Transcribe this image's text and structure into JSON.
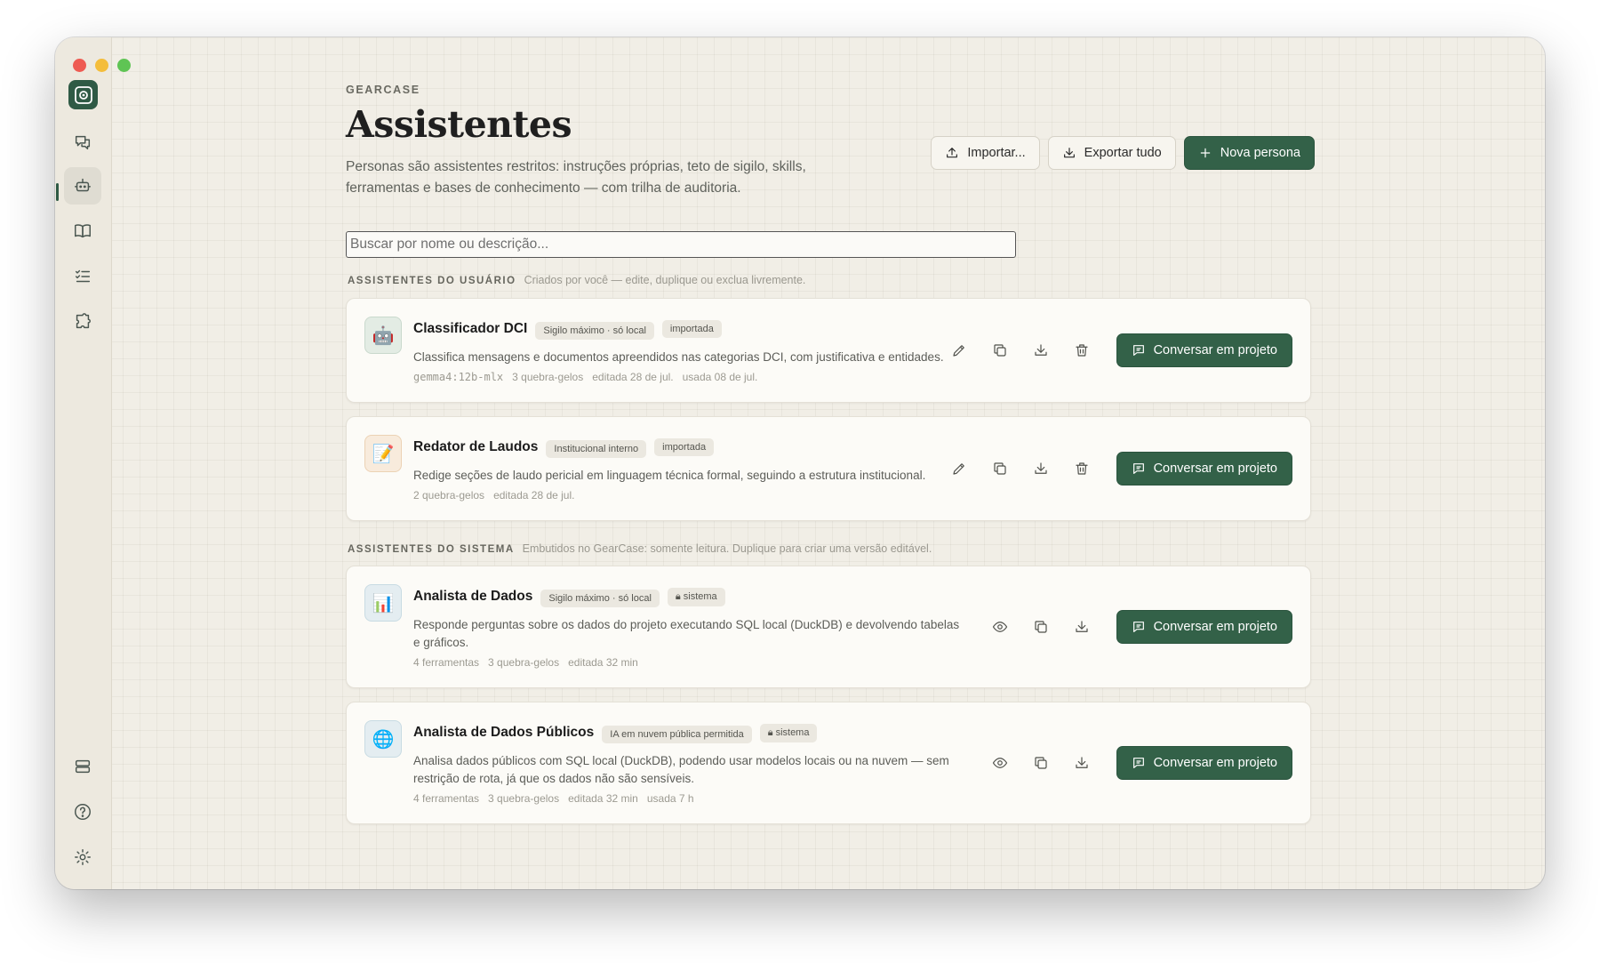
{
  "app": {
    "brand": "GEARCASE",
    "title": "Assistentes",
    "subtitle": "Personas são assistentes restritos: instruções próprias, teto de sigilo, skills, ferramentas e bases de conhecimento — com trilha de auditoria."
  },
  "actions": {
    "import_label": "Importar...",
    "export_label": "Exportar tudo",
    "new_label": "Nova persona"
  },
  "search": {
    "placeholder": "Buscar por nome ou descrição..."
  },
  "sections": [
    {
      "title": "ASSISTENTES DO USUÁRIO",
      "desc": "Criados por você — edite, duplique ou exclua livremente.",
      "cards": [
        {
          "icon": "robot-icon",
          "emoji": "🤖",
          "title": "Classificador DCI",
          "tags": [
            "Sigilo máximo · só local",
            "importada"
          ],
          "desc": "Classifica mensagens e documentos apreendidos nas categorias DCI, com justificativa e entidades.",
          "meta": [
            "gemma4:12b-mlx",
            "3 quebra-gelos",
            "editada 28 de jul.",
            "usada 08 de jul."
          ],
          "chat_label": "Conversar em projeto"
        },
        {
          "icon": "memo-icon",
          "emoji": "📝",
          "title": "Redator de Laudos",
          "tags": [
            "Institucional interno",
            "importada"
          ],
          "desc": "Redige seções de laudo pericial em linguagem técnica formal, seguindo a estrutura institucional.",
          "meta": [
            "2 quebra-gelos",
            "editada 28 de jul."
          ],
          "chat_label": "Conversar em projeto"
        }
      ]
    },
    {
      "title": "ASSISTENTES DO SISTEMA",
      "desc": "Embutidos no GearCase: somente leitura. Duplique para criar uma versão editável.",
      "cards": [
        {
          "icon": "bar-chart-icon",
          "emoji": "📊",
          "title": "Analista de Dados",
          "tags": [
            "Sigilo máximo · só local",
            "sistema"
          ],
          "desc": "Responde perguntas sobre os dados do projeto executando SQL local (DuckDB) e devolvendo tabelas e gráficos.",
          "meta": [
            "4 ferramentas",
            "3 quebra-gelos",
            "editada 32 min"
          ],
          "chat_label": "Conversar em projeto"
        },
        {
          "icon": "globe-icon",
          "emoji": "🌐",
          "title": "Analista de Dados Públicos",
          "tags": [
            "IA em nuvem pública permitida",
            "sistema"
          ],
          "desc": "Analisa dados públicos com SQL local (DuckDB), podendo usar modelos locais ou na nuvem — sem restrição de rota, já que os dados não são sensíveis.",
          "meta": [
            "4 ferramentas",
            "3 quebra-gelos",
            "editada 32 min",
            "usada 7 h"
          ],
          "chat_label": "Conversar em projeto"
        }
      ]
    }
  ],
  "colors": {
    "accent": "#336148",
    "background": "#f1eee6"
  }
}
